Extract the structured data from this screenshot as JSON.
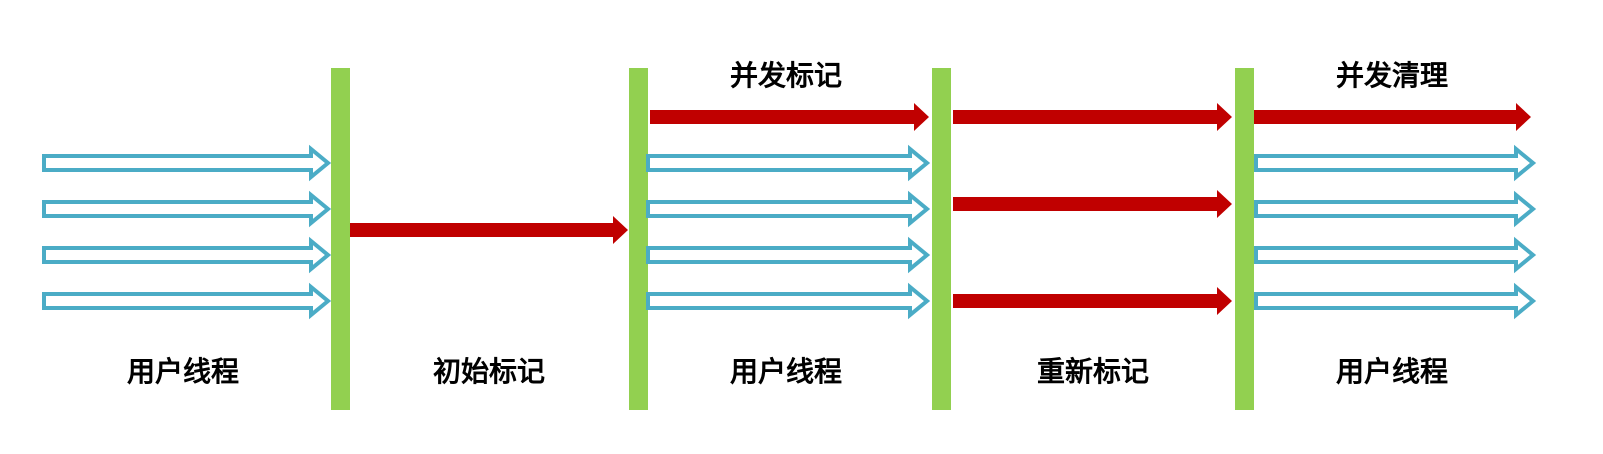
{
  "colors": {
    "barrier": "#92D050",
    "gc_thread": "#C00000",
    "user_thread": "#4BACC6",
    "background": "#FFFFFF"
  },
  "phases": [
    {
      "top_label": "",
      "bottom_label": "用户线程"
    },
    {
      "top_label": "",
      "bottom_label": "初始标记"
    },
    {
      "top_label": "并发标记",
      "bottom_label": "用户线程"
    },
    {
      "top_label": "",
      "bottom_label": "重新标记"
    },
    {
      "top_label": "并发清理",
      "bottom_label": "用户线程"
    }
  ]
}
